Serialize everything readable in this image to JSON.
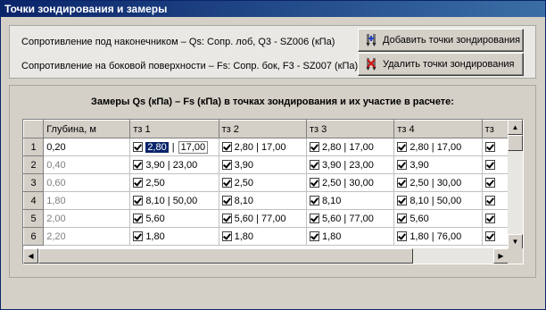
{
  "window": {
    "title": "Точки зондирования и замеры"
  },
  "info": {
    "qs_line": "Сопротивление под наконечником – Qs: Сопр. лоб, Q3 - SZ006 (кПа)",
    "fs_line": "Сопротивление на боковой поверхности – Fs: Сопр. бок, F3 - SZ007 (кПа)"
  },
  "buttons": {
    "add": "Добавить точки зондирования",
    "remove": "Удалить точки зондирования"
  },
  "grid": {
    "caption": "Замеры Qs (кПа) – Fs (кПа) в точках зондирования и их участие в расчете:",
    "headers": [
      "Глубина, м",
      "тз 1",
      "тз 2",
      "тз 3",
      "тз 4",
      "тз"
    ],
    "editing": {
      "qs": "2,80",
      "sep": "|",
      "fs": "17,00"
    },
    "rows": [
      {
        "num": "1",
        "depth": "0,20",
        "cells": [
          "",
          "2,80 | 17,00",
          "2,80 | 17,00",
          "2,80 | 17,00"
        ]
      },
      {
        "num": "2",
        "depth": "0,40",
        "cells": [
          "3,90 | 23,00",
          "3,90",
          "3,90 | 23,00",
          "3,90"
        ]
      },
      {
        "num": "3",
        "depth": "0,60",
        "cells": [
          "2,50",
          "2,50",
          "2,50 | 30,00",
          "2,50 | 30,00"
        ]
      },
      {
        "num": "4",
        "depth": "1,80",
        "cells": [
          "8,10 | 50,00",
          "8,10",
          "8,10",
          "8,10 | 50,00"
        ]
      },
      {
        "num": "5",
        "depth": "2,00",
        "cells": [
          "5,60",
          "5,60 | 77,00",
          "5,60 | 77,00",
          "5,60"
        ]
      },
      {
        "num": "6",
        "depth": "2,20",
        "cells": [
          "1,80",
          "1,80",
          "1,80",
          "1,80 | 76,00"
        ]
      }
    ]
  }
}
